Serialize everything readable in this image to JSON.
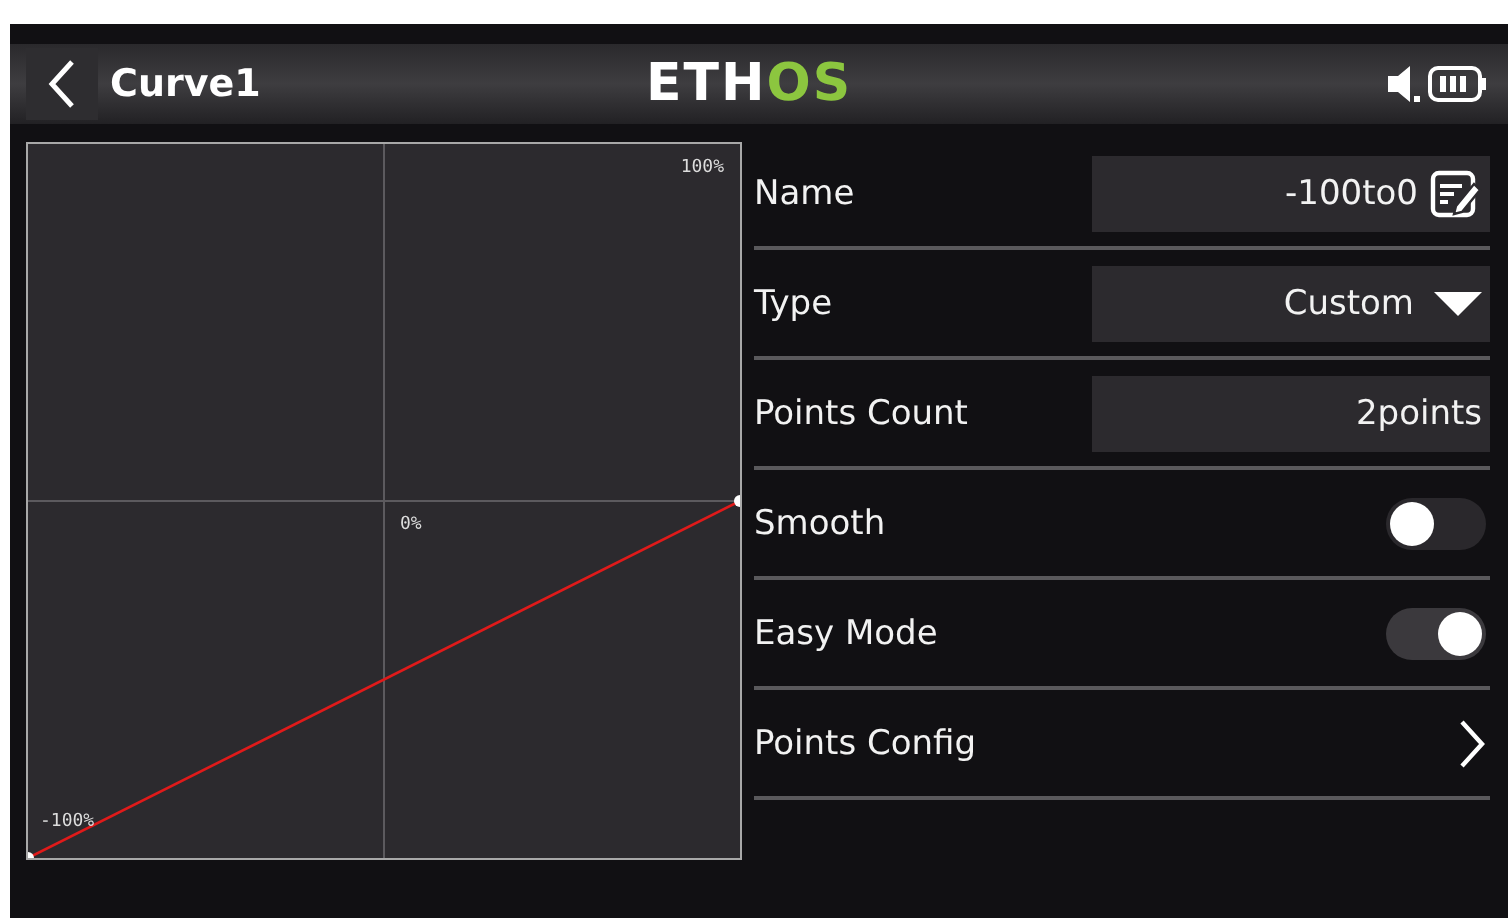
{
  "header": {
    "title": "Curve1",
    "logo": {
      "main": "ETH",
      "accent": "OS"
    }
  },
  "curve": {
    "labels": [
      "100%",
      "0%",
      "-100%"
    ]
  },
  "settings": [
    {
      "kind": "text",
      "label": "Name",
      "value": "-100to0"
    },
    {
      "kind": "dropdown",
      "label": "Type",
      "value": "Custom"
    },
    {
      "kind": "number",
      "label": "Points Count",
      "value": "2points"
    },
    {
      "kind": "toggle",
      "label": "Smooth",
      "on": false
    },
    {
      "kind": "toggle",
      "label": "Easy Mode",
      "on": true
    },
    {
      "kind": "link",
      "label": "Points Config"
    }
  ]
}
